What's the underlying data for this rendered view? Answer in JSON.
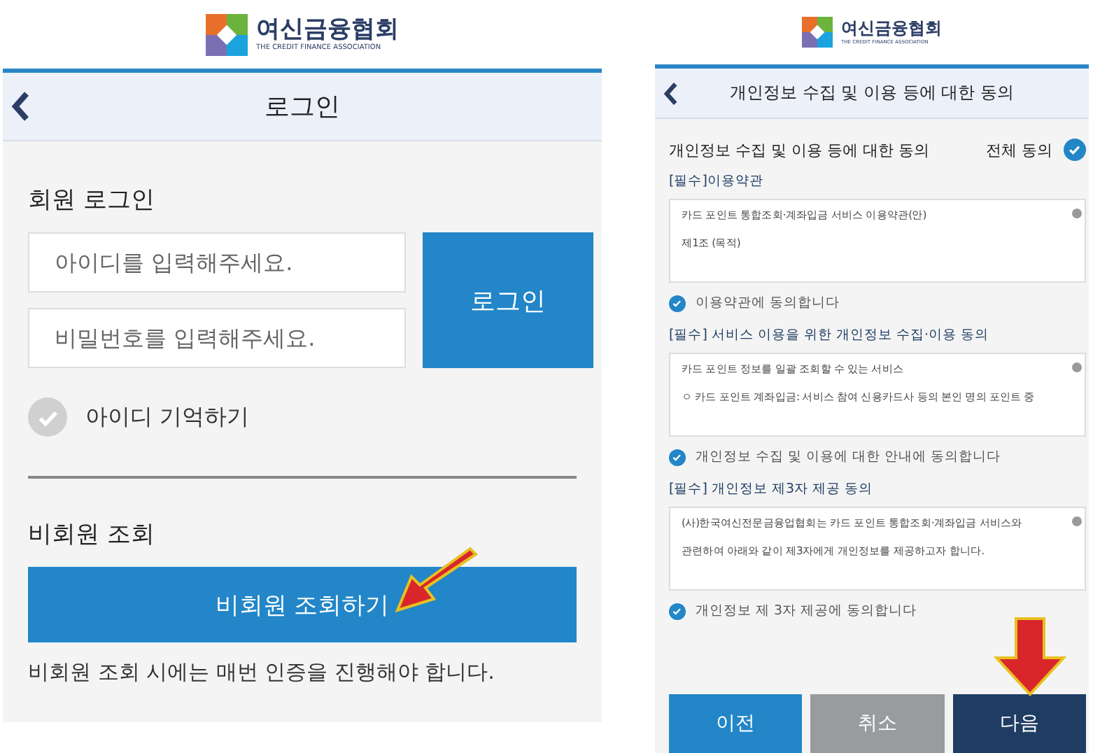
{
  "login_screen": {
    "logo": {
      "name": "여신금융협회",
      "tagline": "THE CREDIT FINANCE ASSOCIATION"
    },
    "header": {
      "title": "로그인"
    },
    "member_section": {
      "heading": "회원 로그인",
      "id_field": {
        "placeholder": "아이디를 입력해주세요."
      },
      "password_field": {
        "placeholder": "비밀번호를 입력해주세요."
      },
      "login_button": "로그인",
      "remember_id": {
        "label": "아이디 기억하기",
        "checked": false
      }
    },
    "guest_section": {
      "heading": "비회원 조회",
      "button": "비회원 조회하기",
      "note": "비회원 조회 시에는 매번 인증을 진행해야 합니다."
    }
  },
  "consent_screen": {
    "logo": {
      "name": "여신금융협회",
      "tagline": "THE CREDIT FINANCE ASSOCIATION"
    },
    "header": {
      "title": "개인정보 수집 및 이용 등에 대한 동의"
    },
    "section_title": "개인정보 수집 및 이용 등에 대한 동의",
    "agree_all": {
      "label": "전체 동의",
      "checked": true
    },
    "agreements": [
      {
        "title": "[필수]이용약관",
        "lines": [
          "카드 포인트 통합조회·계좌입금 서비스 이용약관(안)",
          "제1조 (목적)"
        ],
        "agree": {
          "label": "이용약관에 동의합니다",
          "checked": true
        }
      },
      {
        "title": "[필수] 서비스 이용을 위한 개인정보 수집·이용 동의",
        "lines": [
          "카드 포인트 정보를 일괄 조회할 수 있는 서비스",
          "ㅇ 카드 포인트 계좌입금: 서비스 참여 신용카드사 등의 본인 명의 포인트 중"
        ],
        "agree": {
          "label": "개인정보 수집 및 이용에 대한 안내에 동의합니다",
          "checked": true
        }
      },
      {
        "title": "[필수] 개인정보 제3자 제공 동의",
        "lines": [
          "(사)한국여신전문금융업협회는 카드 포인트 통합조회·계좌입금 서비스와",
          "관련하여 아래와 같이 제3자에게 개인정보를 제공하고자 합니다."
        ],
        "agree": {
          "label": "개인정보 제 3자 제공에 동의합니다",
          "checked": true
        }
      }
    ],
    "buttons": [
      {
        "label": "이전",
        "kind": "primary"
      },
      {
        "label": "취소",
        "kind": "secondary"
      },
      {
        "label": "다음",
        "kind": "dark"
      }
    ]
  }
}
